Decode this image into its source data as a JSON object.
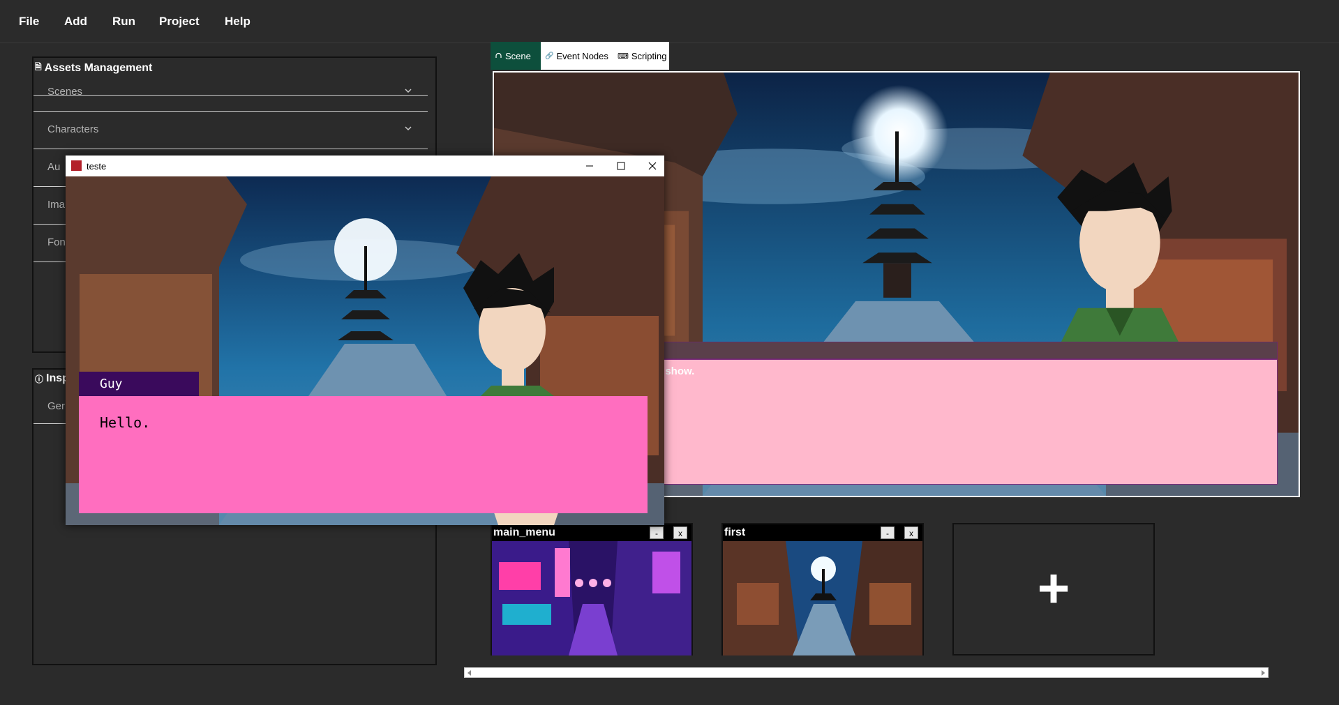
{
  "menu": [
    "File",
    "Add",
    "Run",
    "Project",
    "Help"
  ],
  "assets": {
    "title": "Assets Management",
    "items": [
      "Scenes",
      "Characters",
      "Au",
      "Ima",
      "Fon"
    ]
  },
  "inspector": {
    "title": "Insp",
    "item": "Ger"
  },
  "tabs": {
    "scene": "Scene",
    "event_nodes": "Event Nodes",
    "scripting": "Scripting"
  },
  "preview": {
    "dialog_text": "l show."
  },
  "game_window": {
    "title": "teste",
    "speaker": "Guy",
    "dialog_text": "Hello."
  },
  "scenes": [
    {
      "name": "main_menu",
      "minimize": "-",
      "close": "x"
    },
    {
      "name": "first",
      "minimize": "-",
      "close": "x"
    }
  ],
  "add_scene_symbol": "+",
  "colors": {
    "tab_active": "#0d4f3c",
    "dialog_pink": "#ff6ebf",
    "name_purple": "#3a0a5c",
    "preview_pink": "#ffb8cc"
  }
}
